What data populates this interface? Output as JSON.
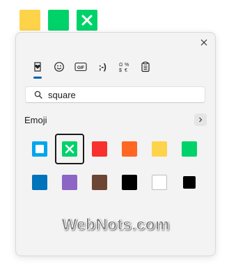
{
  "top_squares": [
    {
      "name": "yellow-square",
      "color": "#fdd34a"
    },
    {
      "name": "green-square",
      "color": "#00d26a"
    },
    {
      "name": "cross-mark-button",
      "color": "#00d26a",
      "icon": "cross-icon"
    }
  ],
  "panel": {
    "tabs": [
      {
        "name": "tab-recently-used",
        "icon": "heart-clock-icon",
        "active": true
      },
      {
        "name": "tab-emoji",
        "icon": "smiley-icon",
        "active": false
      },
      {
        "name": "tab-gif",
        "icon": "gif-icon",
        "label": "GIF",
        "active": false
      },
      {
        "name": "tab-kaomoji",
        "icon": "kaomoji-icon",
        "label": ";-)",
        "active": false
      },
      {
        "name": "tab-symbols",
        "icon": "symbols-icon",
        "active": false
      },
      {
        "name": "tab-clipboard",
        "icon": "clipboard-icon",
        "active": false
      }
    ],
    "search": {
      "value": "square"
    },
    "section": {
      "label": "Emoji"
    },
    "emoji": [
      {
        "name": "blue-square-button",
        "color": "#00a6ed",
        "type": "button"
      },
      {
        "name": "cross-mark-button",
        "color": "#00d26a",
        "type": "cross",
        "selected": true
      },
      {
        "name": "red-square",
        "color": "#f8312f",
        "type": "square"
      },
      {
        "name": "orange-square",
        "color": "#ff6723",
        "type": "square"
      },
      {
        "name": "yellow-square",
        "color": "#fdd34a",
        "type": "square"
      },
      {
        "name": "green-square",
        "color": "#00d26a",
        "type": "square"
      },
      {
        "name": "blue-square",
        "color": "#0074ba",
        "type": "square"
      },
      {
        "name": "purple-square",
        "color": "#8d65c5",
        "type": "square"
      },
      {
        "name": "brown-square",
        "color": "#6d4534",
        "type": "square"
      },
      {
        "name": "black-large-square",
        "color": "#000000",
        "type": "square"
      },
      {
        "name": "white-large-square",
        "color": "#ffffff",
        "type": "white"
      },
      {
        "name": "black-medium-square",
        "color": "#000000",
        "type": "small"
      }
    ]
  },
  "watermark": "WebNots.com"
}
